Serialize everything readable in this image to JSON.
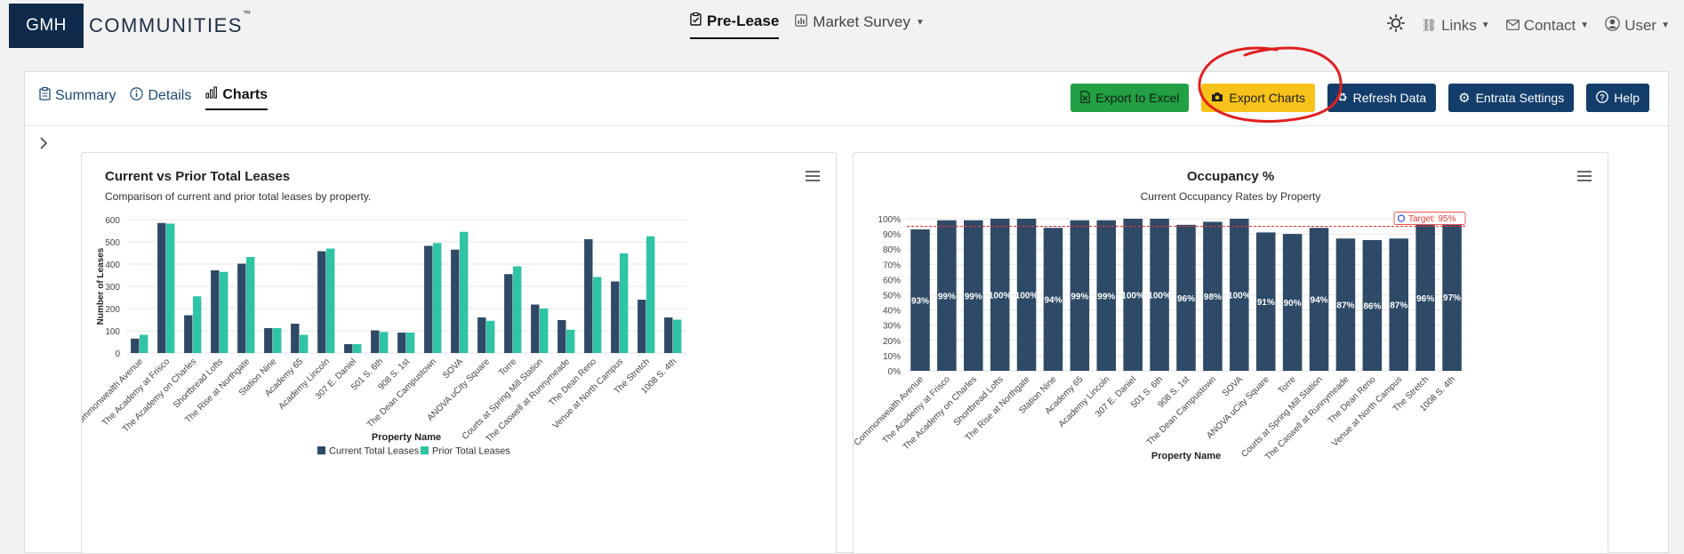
{
  "brand": {
    "box": "GMH",
    "name": "COMMUNITIES",
    "tm": "™"
  },
  "topnav": {
    "prelease": "Pre-Lease",
    "market_survey": "Market Survey",
    "links": "Links",
    "contact": "Contact",
    "user": "User"
  },
  "tabs": {
    "summary": "Summary",
    "details": "Details",
    "charts": "Charts"
  },
  "buttons": {
    "export_excel": "Export to Excel",
    "export_charts": "Export Charts",
    "refresh": "Refresh Data",
    "entrata": "Entrata Settings",
    "help": "Help"
  },
  "colors": {
    "navy": "#2e4a66",
    "teal": "#2ec4a5",
    "target": "#e53935",
    "annotation": "#e02020"
  },
  "chart_data": [
    {
      "type": "bar",
      "title": "Current vs Prior Total Leases",
      "subtitle": "Comparison of current and prior total leases by property.",
      "xlabel": "Property Name",
      "ylabel": "Number of Leases",
      "ylim": [
        0,
        600
      ],
      "yticks": [
        "0",
        "100",
        "200",
        "300",
        "400",
        "500",
        "600"
      ],
      "categories": [
        "Commonwealth Avenue",
        "The Academy at Frisco",
        "The Academy on Charles",
        "Shortbread Lofts",
        "The Rise at Northgate",
        "Station Nine",
        "Academy 65",
        "Academy Lincoln",
        "307 E. Daniel",
        "501 S. 6th",
        "908 S. 1st",
        "The Dean Campustown",
        "SOVA",
        "ANOVA uCity Square",
        "Torre",
        "Courts at Spring Mill Station",
        "The Caswell at Runnymeade",
        "The Dean Reno",
        "Venue at North Campus",
        "The Stretch",
        "1008 S. 4th"
      ],
      "series": [
        {
          "name": "Current Total Leases",
          "values": [
            65,
            585,
            170,
            372,
            402,
            112,
            132,
            458,
            40,
            102,
            92,
            482,
            465,
            160,
            355,
            218,
            148,
            512,
            322,
            240,
            160
          ]
        },
        {
          "name": "Prior Total Leases",
          "values": [
            82,
            582,
            255,
            365,
            432,
            112,
            82,
            470,
            40,
            95,
            92,
            495,
            545,
            145,
            390,
            200,
            105,
            342,
            448,
            525,
            150
          ]
        }
      ],
      "legend": "bottom"
    },
    {
      "type": "bar",
      "title": "Occupancy %",
      "subtitle": "Current Occupancy Rates by Property",
      "xlabel": "Property Name",
      "ylim": [
        0,
        100
      ],
      "yticks": [
        "0%",
        "10%",
        "20%",
        "30%",
        "40%",
        "50%",
        "60%",
        "70%",
        "80%",
        "90%",
        "100%"
      ],
      "categories": [
        "Commonwealth Avenue",
        "The Academy at Frisco",
        "The Academy on Charles",
        "Shortbread Lofts",
        "The Rise at Northgate",
        "Station Nine",
        "Academy 65",
        "Academy Lincoln",
        "307 E. Daniel",
        "501 S. 6th",
        "908 S. 1st",
        "The Dean Campustown",
        "SOVA",
        "ANOVA uCity Square",
        "Torre",
        "Courts at Spring Mill Station",
        "The Caswell at Runnymeade",
        "The Dean Reno",
        "Venue at North Campus",
        "The Stretch",
        "1008 S. 4th"
      ],
      "values": [
        93,
        99,
        99,
        100,
        100,
        94,
        99,
        99,
        100,
        100,
        96,
        98,
        100,
        91,
        90,
        94,
        87,
        86,
        87,
        96,
        97
      ],
      "labels": [
        "93%",
        "99%",
        "99%",
        "100%",
        "100%",
        "94%",
        "99%",
        "99%",
        "100%",
        "100%",
        "96%",
        "98%",
        "100%",
        "91%",
        "90%",
        "94%",
        "87%",
        "86%",
        "87%",
        "96%",
        "97%"
      ],
      "target": {
        "value": 95,
        "label": "Target: 95%"
      }
    }
  ]
}
